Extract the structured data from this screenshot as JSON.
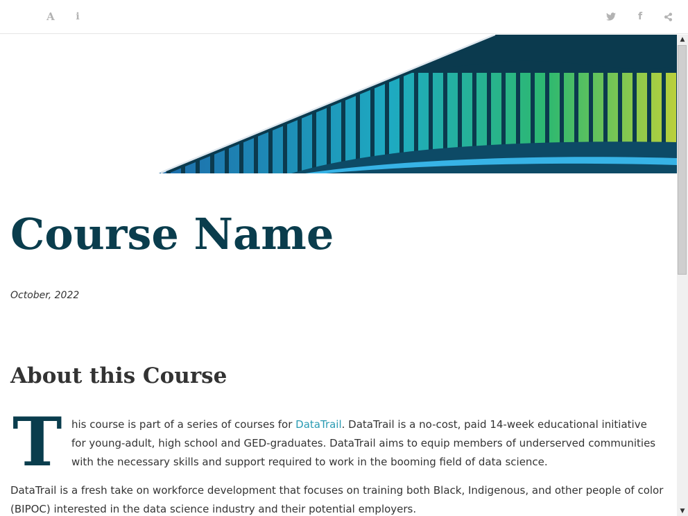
{
  "toolbar": {
    "icons": {
      "font": {
        "glyph": "A",
        "name": "font-settings-icon"
      },
      "info": {
        "glyph": "i",
        "name": "info-icon"
      },
      "twitter": {
        "name": "twitter-icon"
      },
      "facebook": {
        "glyph": "f",
        "name": "facebook-icon"
      },
      "share": {
        "name": "share-icon"
      }
    },
    "icon_color": "#b3b3b3"
  },
  "page": {
    "title": "Course Name",
    "date": "October, 2022",
    "section_heading": "About this Course",
    "dropcap": "T",
    "para1_before_link": "his course is part of a series of courses for ",
    "para1_link": "DataTrail",
    "para1_after_link": ". DataTrail is a no-cost, paid 14-week educational initiative for young-adult, high school and GED-graduates. DataTrail aims to equip members of underserved communities with the necessary skills and support required to work in the booming field of data science.",
    "para2": "DataTrail is a fresh take on workforce development that focuses on training both Black, Indigenous, and other people of color (BIPOC) interested in the data science industry and their potential employers."
  },
  "colors": {
    "title": "#0a3d4d",
    "link": "#2a9bb3",
    "body_text": "#333333",
    "banner_dark": "#0b3a4e"
  },
  "scrollbar": {
    "up_arrow": "▲",
    "down_arrow": "▼"
  }
}
